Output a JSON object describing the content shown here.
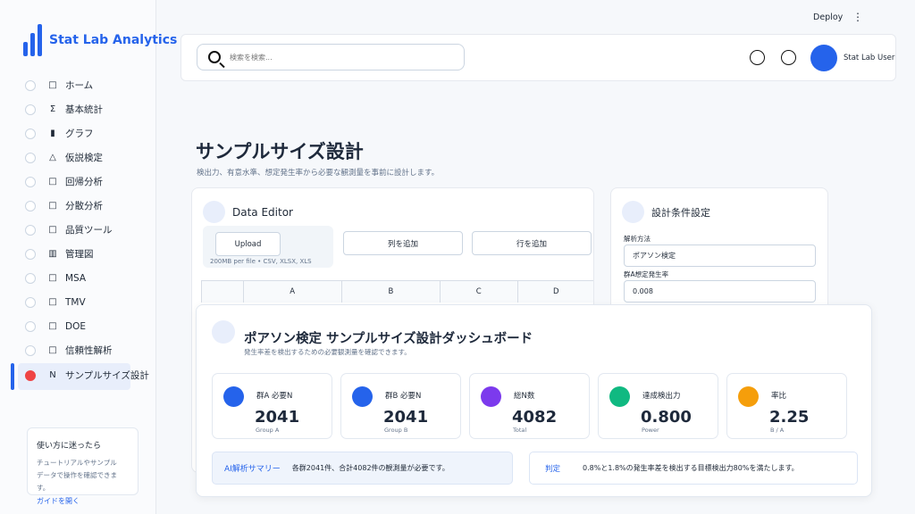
{
  "app": {
    "title": "Stat Lab Analytics"
  },
  "sidebar": {
    "items": [
      {
        "icon": "□",
        "label": "ホーム"
      },
      {
        "icon": "Σ",
        "label": "基本統計"
      },
      {
        "icon": "▮",
        "label": "グラフ"
      },
      {
        "icon": "△",
        "label": "仮説検定"
      },
      {
        "icon": "□",
        "label": "回帰分析"
      },
      {
        "icon": "□",
        "label": "分散分析"
      },
      {
        "icon": "□",
        "label": "品質ツール"
      },
      {
        "icon": "▥",
        "label": "管理図"
      },
      {
        "icon": "□",
        "label": "MSA"
      },
      {
        "icon": "□",
        "label": "TMV"
      },
      {
        "icon": "□",
        "label": "DOE"
      },
      {
        "icon": "□",
        "label": "信頼性解析"
      },
      {
        "icon": "N",
        "label": "サンプルサイズ設計"
      }
    ],
    "help": {
      "title": "使い方に迷ったら",
      "line1": "チュートリアルやサンプル",
      "line2": "データで操作を確認できます。",
      "link": "ガイドを開く"
    }
  },
  "header": {
    "deploy": "Deploy",
    "menu": "⋮",
    "search_placeholder": "検索を検索...",
    "user": "Stat Lab User"
  },
  "page": {
    "title": "サンプルサイズ設計",
    "subtitle": "検出力、有意水準、想定発生率から必要な観測量を事前に設計します。"
  },
  "editor": {
    "title": "Data Editor",
    "upload": "Upload",
    "upload_hint": "200MB per file • CSV, XLSX, XLS",
    "add_column": "列を追加",
    "add_row": "行を追加",
    "columns": [
      "A",
      "B",
      "C",
      "D"
    ]
  },
  "settings": {
    "title": "設計条件設定",
    "method_label": "解析方法",
    "method_value": "ポアソン検定",
    "rate_label": "群A想定発生率",
    "rate_value": "0.008"
  },
  "dashboard": {
    "title": "ポアソン検定 サンプルサイズ設計ダッシュボード",
    "subtitle": "発生率差を検出するための必要観測量を確認できます。",
    "kpis": [
      {
        "label": "群A 必要N",
        "value": "2041",
        "caption": "Group A",
        "color": "#2563eb"
      },
      {
        "label": "群B 必要N",
        "value": "2041",
        "caption": "Group B",
        "color": "#2563eb"
      },
      {
        "label": "総N数",
        "value": "4082",
        "caption": "Total",
        "color": "#7c3aed"
      },
      {
        "label": "達成検出力",
        "value": "0.800",
        "caption": "Power",
        "color": "#10b981"
      },
      {
        "label": "率比",
        "value": "2.25",
        "caption": "B / A",
        "color": "#f59e0b"
      }
    ],
    "summary_tag": "AI解析サマリー",
    "summary_text": "各群2041件、合計4082件の観測量が必要です。",
    "verdict_tag": "判定",
    "verdict_text": "0.8%と1.8%の発生率差を検出する目標検出力80%を満たします。"
  }
}
